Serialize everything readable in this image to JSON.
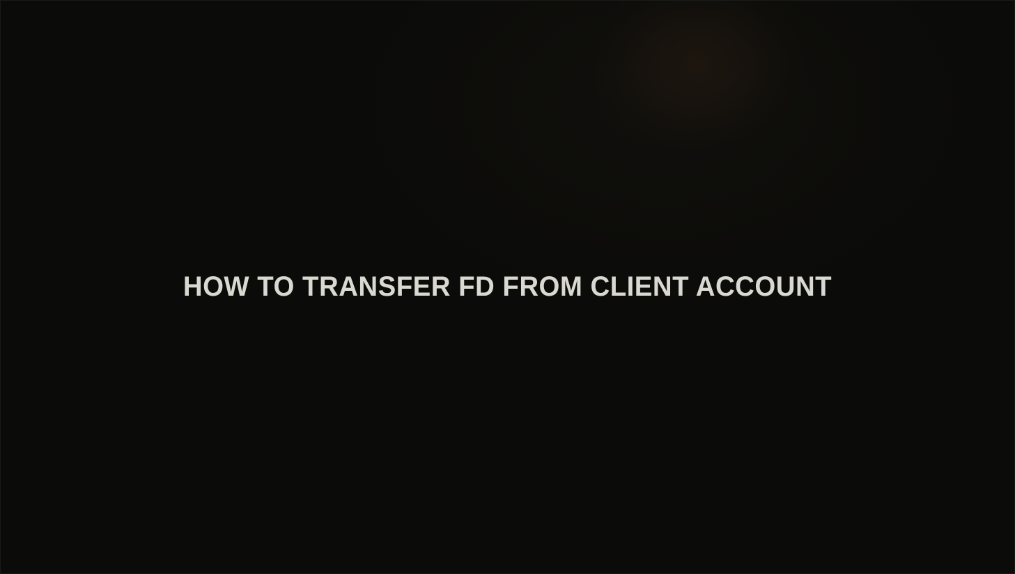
{
  "title_card": {
    "title": "HOW TO TRANSFER FD FROM CLIENT ACCOUNT",
    "text_color": "#d9d9d1",
    "background_color": "#0b0b09"
  }
}
